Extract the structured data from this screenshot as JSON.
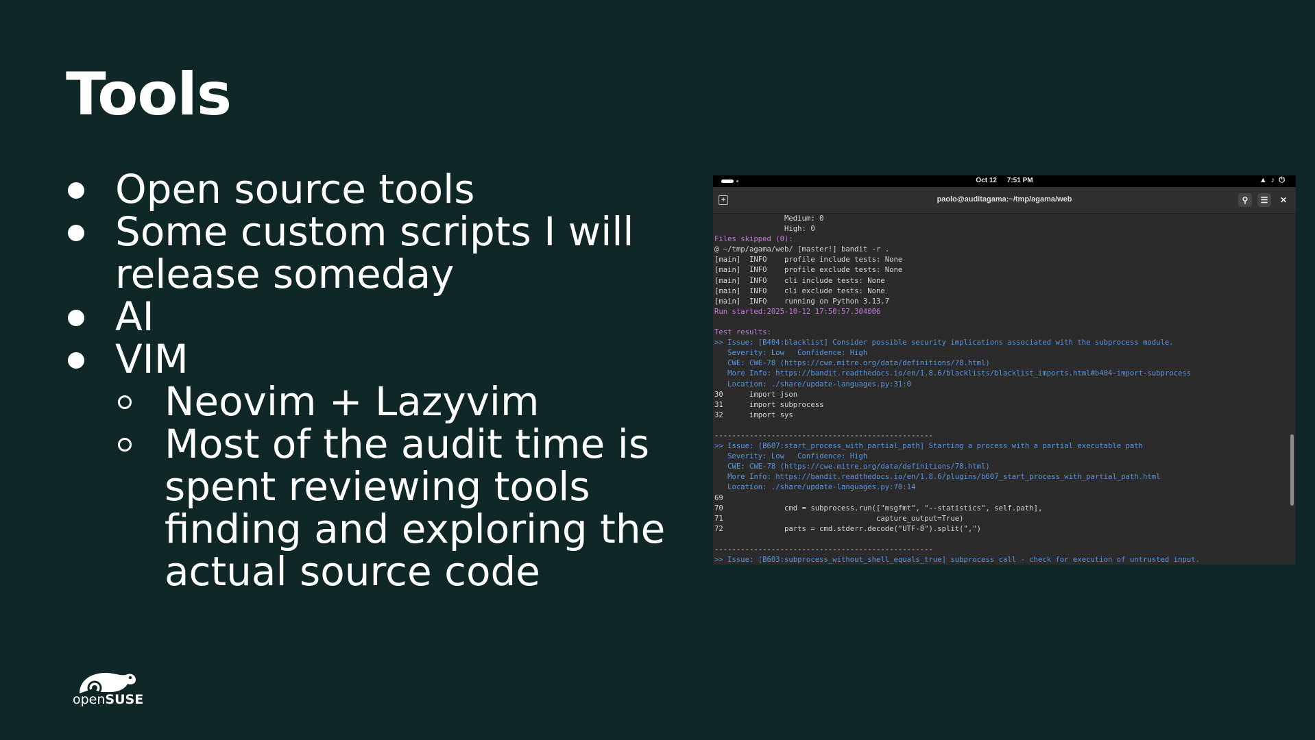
{
  "slide": {
    "title": "Tools",
    "bullets": [
      "Open source tools",
      "Some custom scripts I will release someday",
      "AI",
      "VIM"
    ],
    "sub_bullets": [
      "Neovim + Lazyvim",
      "Most of the audit time is spent reviewing tools finding and exploring the actual source code"
    ],
    "logo_text_light": "open",
    "logo_text_bold": "SUSE"
  },
  "desktop": {
    "date": "Oct 12",
    "time": "7:51 PM",
    "window_title": "paolo@auditagama:~/tmp/agama/web"
  },
  "terminal": {
    "lines": [
      {
        "text": "                Medium: 0",
        "color": "default"
      },
      {
        "text": "                High: 0",
        "color": "default"
      },
      {
        "text": "Files skipped (0):",
        "color": "magenta"
      },
      {
        "text": "@ ~/tmp/agama/web/ [master!] bandit -r .",
        "color": "default"
      },
      {
        "text": "[main]  INFO    profile include tests: None",
        "color": "default"
      },
      {
        "text": "[main]  INFO    profile exclude tests: None",
        "color": "default"
      },
      {
        "text": "[main]  INFO    cli include tests: None",
        "color": "default"
      },
      {
        "text": "[main]  INFO    cli exclude tests: None",
        "color": "default"
      },
      {
        "text": "[main]  INFO    running on Python 3.13.7",
        "color": "default"
      },
      {
        "text": "Run started:2025-10-12 17:50:57.304006",
        "color": "magenta"
      },
      {
        "text": "",
        "color": "default"
      },
      {
        "text": "Test results:",
        "color": "magenta"
      },
      {
        "text": ">> Issue: [B404:blacklist] Consider possible security implications associated with the subprocess module.",
        "color": "blue"
      },
      {
        "text": "   Severity: Low   Confidence: High",
        "color": "blue"
      },
      {
        "text": "   CWE: CWE-78 (https://cwe.mitre.org/data/definitions/78.html)",
        "color": "blue"
      },
      {
        "text": "   More Info: https://bandit.readthedocs.io/en/1.8.6/blacklists/blacklist_imports.html#b404-import-subprocess",
        "color": "blue"
      },
      {
        "text": "   Location: ./share/update-languages.py:31:0",
        "color": "blue"
      },
      {
        "text": "30      import json",
        "color": "default"
      },
      {
        "text": "31      import subprocess",
        "color": "default"
      },
      {
        "text": "32      import sys",
        "color": "default"
      },
      {
        "text": "",
        "color": "default"
      },
      {
        "text": "--------------------------------------------------",
        "color": "default"
      },
      {
        "text": ">> Issue: [B607:start_process_with_partial_path] Starting a process with a partial executable path",
        "color": "blue"
      },
      {
        "text": "   Severity: Low   Confidence: High",
        "color": "blue"
      },
      {
        "text": "   CWE: CWE-78 (https://cwe.mitre.org/data/definitions/78.html)",
        "color": "blue"
      },
      {
        "text": "   More Info: https://bandit.readthedocs.io/en/1.8.6/plugins/b607_start_process_with_partial_path.html",
        "color": "blue"
      },
      {
        "text": "   Location: ./share/update-languages.py:70:14",
        "color": "blue"
      },
      {
        "text": "69",
        "color": "default"
      },
      {
        "text": "70              cmd = subprocess.run([\"msgfmt\", \"--statistics\", self.path],",
        "color": "default"
      },
      {
        "text": "71                                   capture_output=True)",
        "color": "default"
      },
      {
        "text": "72              parts = cmd.stderr.decode(\"UTF-8\").split(\",\")",
        "color": "default"
      },
      {
        "text": "",
        "color": "default"
      },
      {
        "text": "--------------------------------------------------",
        "color": "default"
      },
      {
        "text": ">> Issue: [B603:subprocess_without_shell_equals_true] subprocess call - check for execution of untrusted input.",
        "color": "blue"
      }
    ]
  }
}
